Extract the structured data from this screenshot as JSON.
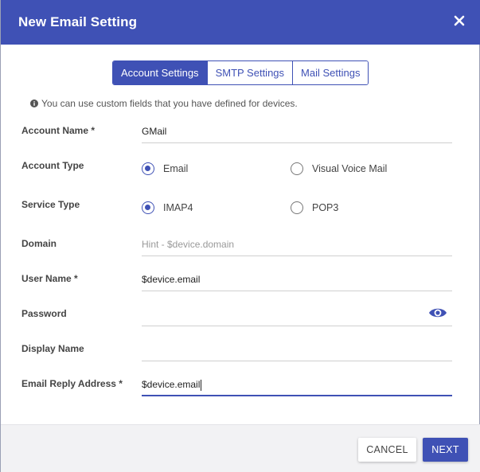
{
  "dialog": {
    "title": "New Email Setting",
    "close_icon": "close-icon"
  },
  "tabs": [
    {
      "label": "Account Settings",
      "active": true
    },
    {
      "label": "SMTP Settings",
      "active": false
    },
    {
      "label": "Mail Settings",
      "active": false
    }
  ],
  "info": {
    "icon": "info-icon",
    "text": "You can use custom fields that you have defined for devices."
  },
  "form": {
    "account_name": {
      "label": "Account Name *",
      "value": "GMail"
    },
    "account_type": {
      "label": "Account Type",
      "options": [
        {
          "label": "Email",
          "checked": true
        },
        {
          "label": "Visual Voice Mail",
          "checked": false
        }
      ]
    },
    "service_type": {
      "label": "Service Type",
      "options": [
        {
          "label": "IMAP4",
          "checked": true
        },
        {
          "label": "POP3",
          "checked": false
        }
      ]
    },
    "domain": {
      "label": "Domain",
      "value": "",
      "placeholder": "Hint - $device.domain"
    },
    "user_name": {
      "label": "User Name *",
      "value": "$device.email"
    },
    "password": {
      "label": "Password",
      "value": "",
      "toggle_icon": "eye-icon"
    },
    "display_name": {
      "label": "Display Name",
      "value": ""
    },
    "email_reply_address": {
      "label": "Email Reply Address *",
      "value": "$device.email"
    }
  },
  "footer": {
    "cancel_label": "CANCEL",
    "next_label": "NEXT"
  },
  "colors": {
    "primary": "#3f51b5",
    "footer_bg": "#f2f2f4"
  }
}
